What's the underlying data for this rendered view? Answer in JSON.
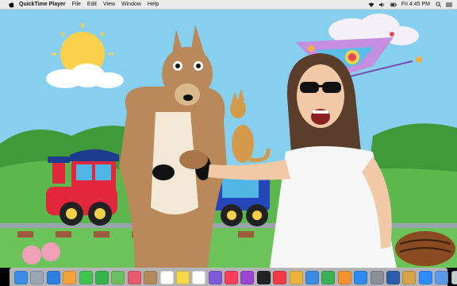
{
  "menubar": {
    "app_name": "QuickTime Player",
    "menus": [
      "File",
      "Edit",
      "View",
      "Window",
      "Help"
    ],
    "clock": "Fri 4:45 PM",
    "status_icons": [
      "wifi-icon",
      "volume-icon",
      "battery-icon",
      "search-icon",
      "control-center-icon"
    ]
  },
  "dock": {
    "apps": [
      {
        "name": "finder",
        "color": "#3a8ee6"
      },
      {
        "name": "launchpad",
        "color": "#9aa4b3"
      },
      {
        "name": "safari",
        "color": "#2f7fe0"
      },
      {
        "name": "photos",
        "color": "#f2a33a"
      },
      {
        "name": "messages",
        "color": "#3ec44f"
      },
      {
        "name": "facetime",
        "color": "#36b34a"
      },
      {
        "name": "maps",
        "color": "#6cbf5e"
      },
      {
        "name": "photos-app",
        "color": "#e9596f"
      },
      {
        "name": "contacts",
        "color": "#b38a5c"
      },
      {
        "name": "calendar",
        "color": "#ffffff"
      },
      {
        "name": "notes",
        "color": "#f6d84a"
      },
      {
        "name": "reminders",
        "color": "#ffffff"
      },
      {
        "name": "imovie",
        "color": "#7b5cd6"
      },
      {
        "name": "music",
        "color": "#fa3e5b"
      },
      {
        "name": "podcasts",
        "color": "#9b45d0"
      },
      {
        "name": "tv",
        "color": "#222222"
      },
      {
        "name": "news",
        "color": "#ee3b45"
      },
      {
        "name": "chrome",
        "color": "#e8b43a"
      },
      {
        "name": "keynote",
        "color": "#3a8be0"
      },
      {
        "name": "numbers",
        "color": "#3cb054"
      },
      {
        "name": "pages",
        "color": "#f09233"
      },
      {
        "name": "app-store",
        "color": "#2d8af0"
      },
      {
        "name": "system-preferences",
        "color": "#8a8f96"
      },
      {
        "name": "quicktime",
        "color": "#2b5ea8"
      },
      {
        "name": "preview",
        "color": "#d9a34a"
      },
      {
        "name": "zoom",
        "color": "#2d8cff"
      },
      {
        "name": "finder-2",
        "color": "#5a9ae8"
      },
      {
        "name": "trash",
        "color": "#c8ccd2"
      }
    ]
  }
}
